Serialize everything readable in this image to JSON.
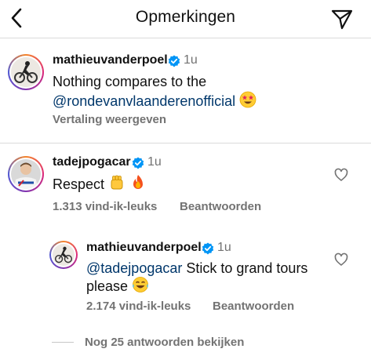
{
  "header": {
    "title": "Opmerkingen",
    "back_icon": "chevron-left-icon",
    "send_icon": "paper-plane-icon"
  },
  "comments": [
    {
      "username": "mathieuvanderpoel",
      "verified": true,
      "time": "1u",
      "text_line1": "Nothing compares to the",
      "mention": "@rondevanvlaanderenofficial",
      "emoji": "star-struck-emoji",
      "translate_label": "Vertaling weergeven"
    },
    {
      "username": "tadejpogacar",
      "verified": true,
      "time": "1u",
      "text": "Respect",
      "emojis": [
        "raised-fist-emoji",
        "fire-emoji"
      ],
      "likes": "1.313 vind-ik-leuks",
      "reply_label": "Beantwoorden"
    }
  ],
  "reply": {
    "username": "mathieuvanderpoel",
    "verified": true,
    "time": "1u",
    "mention": "@tadejpogacar",
    "text_line1": " Stick to grand tours",
    "text_line2": "please",
    "emoji": "tears-of-joy-emoji",
    "likes": "2.174 vind-ik-leuks",
    "reply_label": "Beantwoorden"
  },
  "view_more_replies": "Nog 25 antwoorden bekijken",
  "colors": {
    "verified_blue": "#0095f6",
    "mention_blue": "#00376b",
    "secondary_text": "#737373",
    "divider": "#dbdbdb"
  }
}
